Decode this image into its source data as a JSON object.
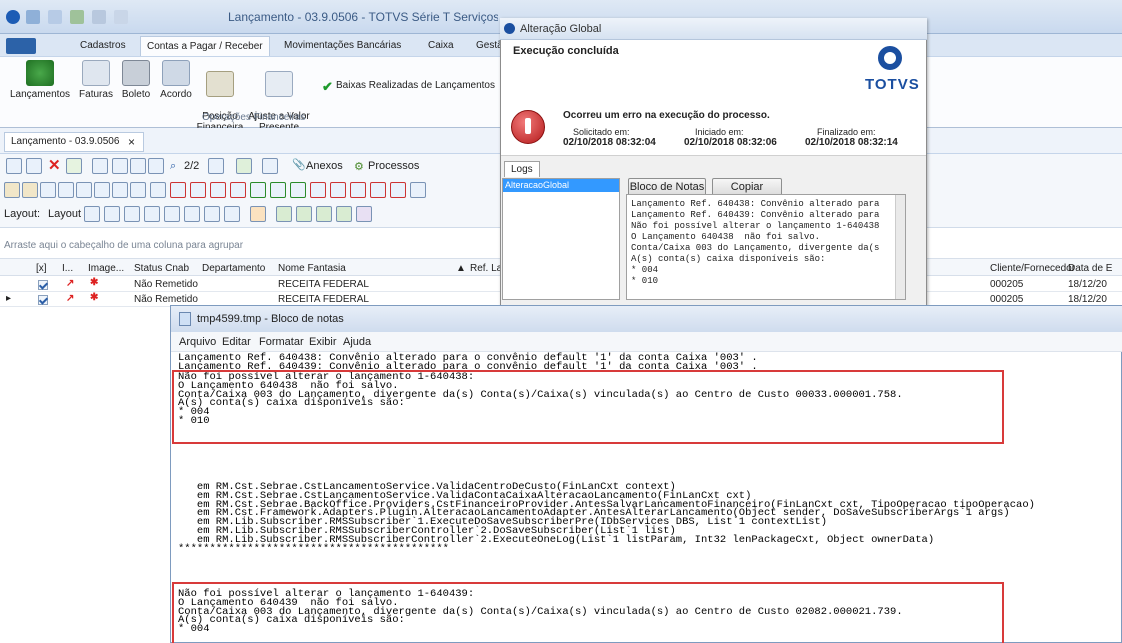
{
  "window": {
    "title": "Lançamento - 03.9.0506 - TOTVS Série T Serviços"
  },
  "ribbon_tabs": [
    "Cadastros",
    "Contas a Pagar / Receber",
    "Movimentações Bancárias",
    "Caixa",
    "Gestã"
  ],
  "ribbon": {
    "buttons": [
      "Lançamentos",
      "Faturas",
      "Boleto",
      "Acordo",
      "Posição\nFinanceira",
      "Ajuste a Valor\nPresente"
    ],
    "group_label": "Operações Financeiras",
    "checked_item": "Baixas Realizadas de Lançamentos"
  },
  "doc_tab": {
    "label": "Lançamento - 03.9.0506",
    "close": "×"
  },
  "toolbar": {
    "page": "2/2",
    "anexos": "Anexos",
    "processos": "Processos",
    "layout_label": "Layout:",
    "layout_button": "Layout"
  },
  "grid": {
    "group_hint": "Arraste aqui o cabeçalho de uma coluna para agrupar",
    "columns": [
      "[x]",
      "I...",
      "Image...",
      "Status Cnab",
      "Departamento",
      "Nome Fantasia",
      "Ref. Lançan"
    ],
    "right_columns": [
      "Cliente/Fornecedor",
      "Data de E"
    ],
    "rows": [
      {
        "status": "Não Remetido",
        "nome": "RECEITA FEDERAL",
        "cliente": "000205",
        "data": "18/12/20"
      },
      {
        "status": "Não Remetido",
        "nome": "RECEITA FEDERAL",
        "cliente": "000205",
        "data": "18/12/20"
      }
    ]
  },
  "dialog": {
    "title": "Alteração Global",
    "heading": "Execução concluída",
    "logo": "TOTVS",
    "error_title": "Ocorreu um erro na execução do processo.",
    "solicitado_label": "Solicitado em:",
    "solicitado": "02/10/2018 08:32:04",
    "iniciado_label": "Iniciado em:",
    "iniciado": "02/10/2018 08:32:06",
    "finalizado_label": "Finalizado em:",
    "finalizado": "02/10/2018 08:32:14",
    "logs_tab": "Logs",
    "list_item": "AlteracaoGlobal",
    "notepad_button": "Bloco de Notas",
    "copy_button": "Copiar",
    "log_lines": [
      "Lançamento Ref. 640438: Convênio alterado para",
      "Lançamento Ref. 640439: Convênio alterado para",
      "Não foi possível alterar o lançamento 1-640438",
      "O Lançamento 640438  não foi salvo.",
      "Conta/Caixa 003 do Lançamento, divergente da(s",
      "A(s) conta(s) caixa disponíveis são:",
      "* 004",
      "* 010"
    ]
  },
  "notepad": {
    "title": "tmp4599.tmp - Bloco de notas",
    "menu": [
      "Arquivo",
      "Editar",
      "Formatar",
      "Exibir",
      "Ajuda"
    ],
    "lines_a": [
      "Lançamento Ref. 640438: Convênio alterado para o convênio default '1' da conta Caixa '003' .",
      "Lançamento Ref. 640439: Convênio alterado para o convênio default '1' da conta Caixa '003' ."
    ],
    "lines_b": [
      "Não foi possível alterar o lançamento 1-640438:",
      "O Lançamento 640438  não foi salvo.",
      "Conta/Caixa 003 do Lançamento, divergente da(s) Conta(s)/Caixa(s) vinculada(s) ao Centro de Custo 00033.000001.758.",
      "A(s) conta(s) caixa disponíveis são:",
      "* 004",
      "* 010"
    ],
    "lines_c": [
      "   em RM.Cst.Sebrae.CstLancamentoService.ValidaCentroDeCusto(FinLanCxt context)",
      "   em RM.Cst.Sebrae.CstLancamentoService.ValidaContaCaixaAlteracaoLancamento(FinLanCxt cxt)",
      "   em RM.Cst.Sebrae.BackOffice.Providers.CstFinanceiroProvider.AntesSalvarLancamentoFinanceiro(FinLanCxt cxt, TipoOperacao tipoOperacao)",
      "   em RM.Cst.Framework.Adapters.Plugin.AlteracaoLancamentoAdapter.AntesAlterarLancamento(Object sender, DoSaveSubscriberArgs`1 args)",
      "   em RM.Lib.Subscriber.RMSSubscriber`1.ExecuteDoSaveSubscriberPre(IDbServices DBS, List`1 contextList)",
      "   em RM.Lib.Subscriber.RMSSubscriberController`2.DoSaveSubscriber(List`1 list)",
      "   em RM.Lib.Subscriber.RMSSubscriberController`2.ExecuteOneLog(List`1 listParam, Int32 lenPackageCxt, Object ownerData)",
      "*******************************************"
    ],
    "lines_d": [
      "Não foi possível alterar o lançamento 1-640439:",
      "O Lançamento 640439  não foi salvo.",
      "Conta/Caixa 003 do Lançamento, divergente da(s) Conta(s)/Caixa(s) vinculada(s) ao Centro de Custo 02082.000021.739.",
      "A(s) conta(s) caixa disponíveis são:",
      "* 004"
    ]
  },
  "colors": {
    "accent": "#2b5ea7",
    "error": "#d83a3a",
    "totvs": "#1b4fa0"
  }
}
